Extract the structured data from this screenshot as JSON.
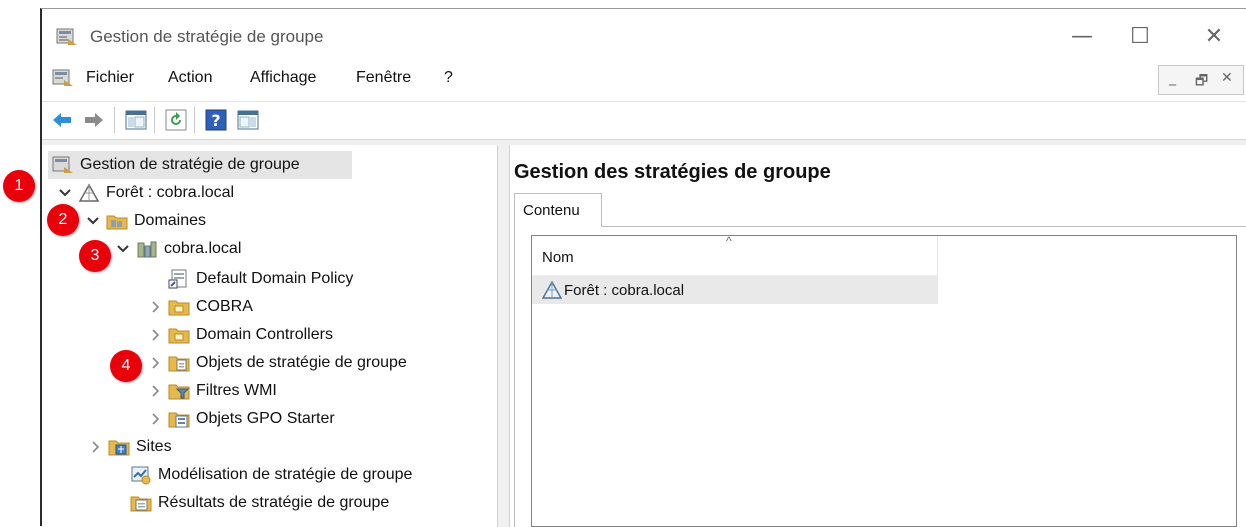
{
  "window": {
    "title": "Gestion de stratégie de groupe"
  },
  "window_controls": {
    "minimize": "—",
    "maximize": "☐",
    "close": "✕"
  },
  "menubar": {
    "items": [
      "Fichier",
      "Action",
      "Affichage",
      "Fenêtre",
      "?"
    ]
  },
  "mdi_controls": {
    "minimize": "_",
    "restore": "🗗",
    "close": "✕"
  },
  "toolbar": {
    "buttons": [
      "back-arrow-icon",
      "forward-arrow-icon",
      "show-hide-console-tree-icon",
      "refresh-icon",
      "help-icon",
      "show-hide-action-pane-icon"
    ]
  },
  "tree": {
    "root": "Gestion de stratégie de groupe",
    "forest": "Forêt : cobra.local",
    "domains": "Domaines",
    "domain": "cobra.local",
    "default_policy": "Default Domain Policy",
    "cobra_ou": "COBRA",
    "domain_controllers": "Domain Controllers",
    "gpo": "Objets de stratégie de groupe",
    "wmi": "Filtres WMI",
    "starter": "Objets GPO Starter",
    "sites": "Sites",
    "modeling": "Modélisation de stratégie de groupe",
    "results": "Résultats de stratégie de groupe"
  },
  "badges": [
    "1",
    "2",
    "3",
    "4"
  ],
  "right_pane": {
    "title": "Gestion des stratégies de groupe",
    "tab": "Contenu",
    "column_name": "Nom",
    "sort_indicator": "^",
    "rows": [
      "Forêt : cobra.local"
    ]
  },
  "colors": {
    "badge": "#e8000b",
    "selection": "#e5e5e5",
    "folder": "#e7b84a",
    "help_blue": "#2f5fb8"
  }
}
